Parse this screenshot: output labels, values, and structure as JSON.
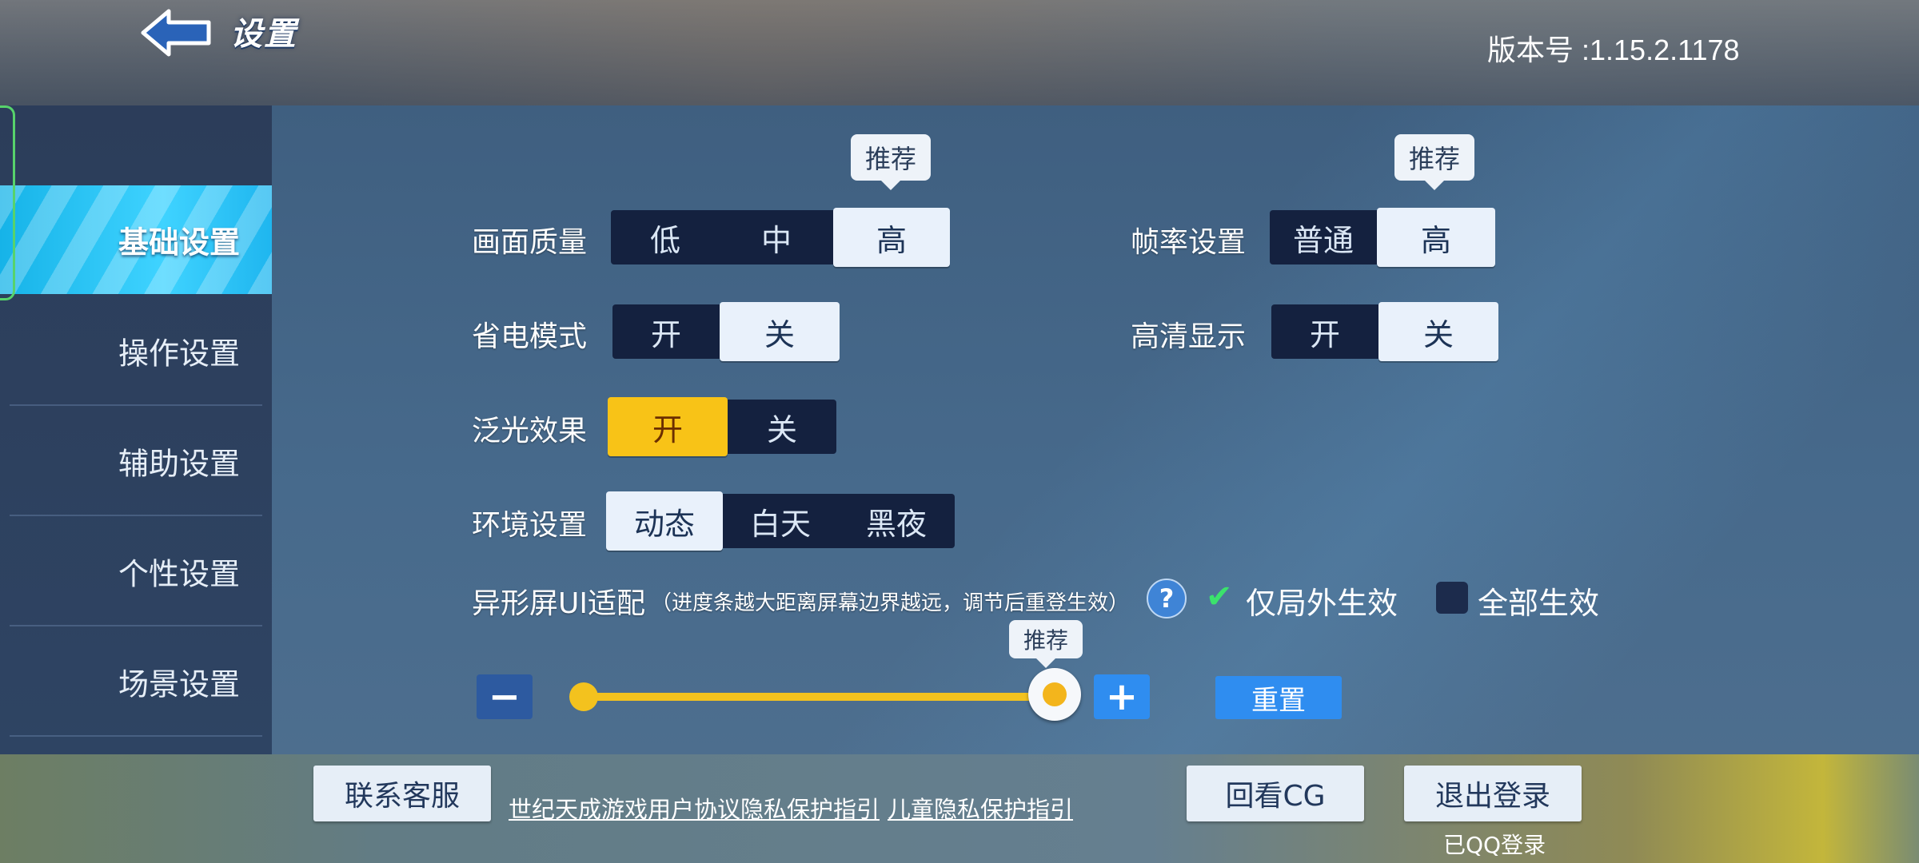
{
  "header": {
    "title": "设置",
    "version": "版本号 :1.15.2.1178",
    "back_icon": "back-arrow-icon"
  },
  "sidebar": {
    "items": [
      {
        "label": "基础设置",
        "active": true
      },
      {
        "label": "操作设置"
      },
      {
        "label": "辅助设置"
      },
      {
        "label": "个性设置"
      },
      {
        "label": "场景设置"
      }
    ]
  },
  "settings": {
    "graphics": {
      "label": "画面质量",
      "options": [
        "低",
        "中",
        "高"
      ],
      "selected": "高",
      "tip": "推荐"
    },
    "framerate": {
      "label": "帧率设置",
      "options": [
        "普通",
        "高"
      ],
      "selected": "高",
      "tip": "推荐"
    },
    "power_save": {
      "label": "省电模式",
      "options": [
        "开",
        "关"
      ],
      "selected": "关"
    },
    "hd_display": {
      "label": "高清显示",
      "options": [
        "开",
        "关"
      ],
      "selected": "关"
    },
    "bloom": {
      "label": "泛光效果",
      "options": [
        "开",
        "关"
      ],
      "selected": "开"
    },
    "environment": {
      "label": "环境设置",
      "options": [
        "动态",
        "白天",
        "黑夜"
      ],
      "selected": "动态"
    },
    "notch": {
      "label": "异形屏UI适配",
      "note": "（进度条越大距离屏幕边界越远，调节后重登生效）",
      "help": "?",
      "option_outside": "仅局外生效",
      "option_all": "全部生效",
      "selected": "仅局外生效",
      "slider_tip": "推荐",
      "slider_value": 1.0,
      "reset": "重置",
      "minus": "−",
      "plus": "+"
    }
  },
  "footer": {
    "contact": "联系客服",
    "links": [
      "世纪天成游戏用户协议",
      "隐私保护指引",
      "儿童隐私保护指引"
    ],
    "replay_cg": "回看CG",
    "logout": "退出登录",
    "login_status": "已QQ登录"
  },
  "colors": {
    "accent_blue": "#2f8df0",
    "active_yellow": "#f8c317",
    "check_green": "#3be26c"
  }
}
